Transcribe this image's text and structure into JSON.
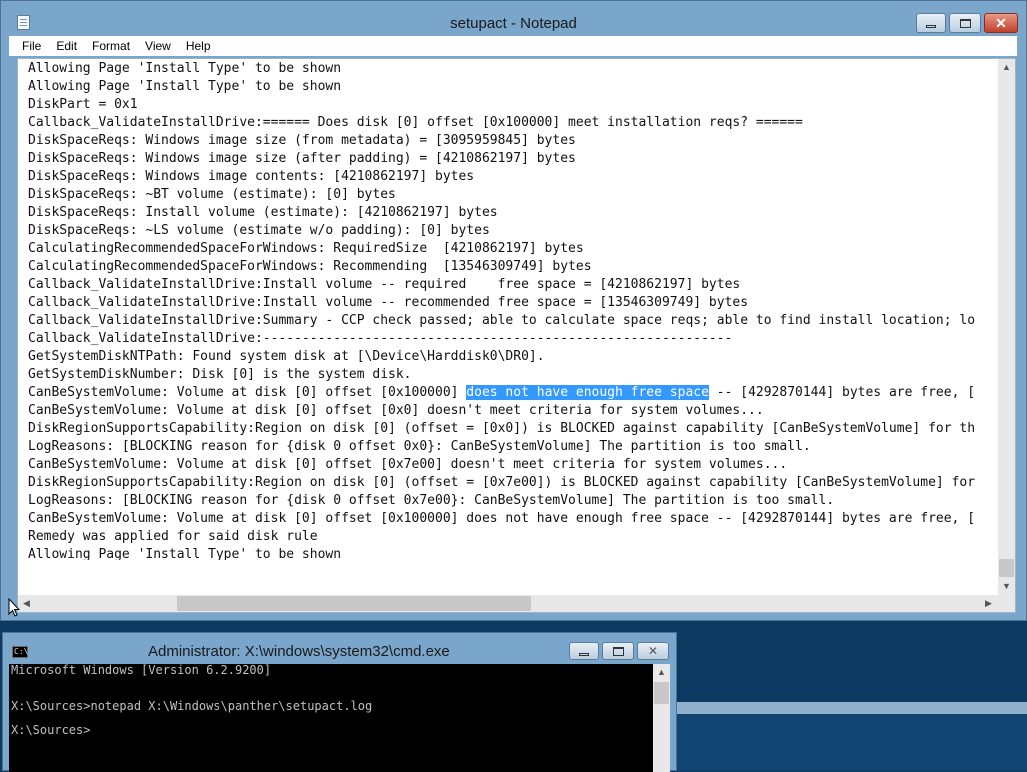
{
  "notepad": {
    "title": "setupact - Notepad",
    "menu": [
      "File",
      "Edit",
      "Format",
      "View",
      "Help"
    ],
    "lines": [
      "Allowing Page 'Install Type' to be shown",
      "Allowing Page 'Install Type' to be shown",
      "DiskPart = 0x1",
      "Callback_ValidateInstallDrive:====== Does disk [0] offset [0x100000] meet installation reqs? ======",
      "DiskSpaceReqs: Windows image size (from metadata) = [3095959845] bytes",
      "DiskSpaceReqs: Windows image size (after padding) = [4210862197] bytes",
      "DiskSpaceReqs: Windows image contents: [4210862197] bytes",
      "DiskSpaceReqs: ~BT volume (estimate): [0] bytes",
      "DiskSpaceReqs: Install volume (estimate): [4210862197] bytes",
      "DiskSpaceReqs: ~LS volume (estimate w/o padding): [0] bytes",
      "CalculatingRecommendedSpaceForWindows: RequiredSize  [4210862197] bytes",
      "CalculatingRecommendedSpaceForWindows: Recommending  [13546309749] bytes",
      "Callback_ValidateInstallDrive:Install volume -- required    free space = [4210862197] bytes",
      "Callback_ValidateInstallDrive:Install volume -- recommended free space = [13546309749] bytes",
      "Callback_ValidateInstallDrive:Summary - CCP check passed; able to calculate space reqs; able to find install location; lo",
      "Callback_ValidateInstallDrive:------------------------------------------------------------",
      "GetSystemDiskNTPath: Found system disk at [\\Device\\Harddisk0\\DR0].",
      "GetSystemDiskNumber: Disk [0] is the system disk.",
      "CanBeSystemVolume: Volume at disk [0] offset [0x100000] does not have enough free space -- [4292870144] bytes are free, [",
      "CanBeSystemVolume: Volume at disk [0] offset [0x0] doesn't meet criteria for system volumes...",
      "DiskRegionSupportsCapability:Region on disk [0] (offset = [0x0]) is BLOCKED against capability [CanBeSystemVolume] for th",
      "LogReasons: [BLOCKING reason for {disk 0 offset 0x0}: CanBeSystemVolume] The partition is too small.",
      "CanBeSystemVolume: Volume at disk [0] offset [0x7e00] doesn't meet criteria for system volumes...",
      "DiskRegionSupportsCapability:Region on disk [0] (offset = [0x7e00]) is BLOCKED against capability [CanBeSystemVolume] for",
      "LogReasons: [BLOCKING reason for {disk 0 offset 0x7e00}: CanBeSystemVolume] The partition is too small.",
      "CanBeSystemVolume: Volume at disk [0] offset [0x100000] does not have enough free space -- [4292870144] bytes are free, [",
      "Remedy was applied for said disk rule",
      "Allowing Page 'Install Type' to be shown"
    ],
    "selection": {
      "line": 18,
      "text": "does not have enough free space"
    }
  },
  "cmd": {
    "title": "Administrator: X:\\windows\\system32\\cmd.exe",
    "lines": [
      "Microsoft Windows [Version 6.2.9200]",
      "",
      "",
      "X:\\Sources>notepad X:\\Windows\\panther\\setupact.log",
      "",
      "X:\\Sources>"
    ]
  },
  "colors": {
    "window_frame": "#7aa6cb",
    "selection": "#3399ff",
    "close_button": "#c2402a",
    "desktop": "#0c3a63"
  }
}
